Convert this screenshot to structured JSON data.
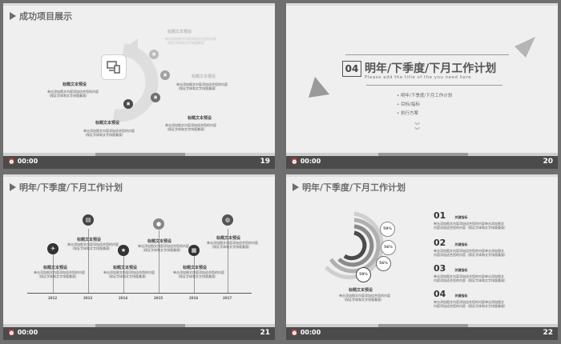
{
  "slide19": {
    "title": "成功项目展示",
    "labels": [
      "标题文本预设",
      "标题文本预设",
      "标题文本预设",
      "标题文本预设",
      "标题文本预设"
    ],
    "desc_a": "单击添加图文内容添加适合您的内容",
    "desc_b": "（保证字体和文字排版美观）",
    "time": "00:00",
    "page": "19"
  },
  "slide20": {
    "number": "04",
    "heading": "明年/下季度/下月工作计划",
    "subtitle": "Please add the title of the you need here",
    "items": [
      "明年/下季度/下月工作计划",
      "目标/指标",
      "执行方案"
    ],
    "time": "00:00",
    "page": "20"
  },
  "slide21": {
    "title": "明年/下季度/下月工作计划",
    "label": "标题文本预设",
    "desc_a": "单击添加图文内容添加适合您的内容",
    "desc_b": "（保证字体和文字排版美观）",
    "years": [
      "2012",
      "2013",
      "2014",
      "2015",
      "2016",
      "2017"
    ],
    "time": "00:00",
    "page": "21"
  },
  "slide22": {
    "title": "明年/下季度/下月工作计划",
    "percents": [
      "59%",
      "56%",
      "56%",
      "59%"
    ],
    "center_label": "标题文本预设",
    "center_desc_a": "单击添加图文内容添加适合您的内容",
    "center_desc_b": "（保证字体和文字排版美观）",
    "rows": [
      {
        "num": "01",
        "title": "关键指标",
        "line1": "单击添加图文内容添加适合您的内容单击添加图文",
        "line2": "内容添加适合您的内容（保证字体和文字排版美观）"
      },
      {
        "num": "02",
        "title": "关键指标",
        "line1": "单击添加图文内容添加适合您的内容单击添加图文",
        "line2": "内容添加适合您的内容（保证字体和文字排版美观）"
      },
      {
        "num": "03",
        "title": "关键指标",
        "line1": "单击添加图文内容添加适合您的内容单击添加图文",
        "line2": "内容添加适合您的内容（保证字体和文字排版美观）"
      },
      {
        "num": "04",
        "title": "关键指标",
        "line1": "单击添加图文内容添加适合您的内容单击添加图文",
        "line2": "内容添加适合您的内容（保证字体和文字排版美观）"
      }
    ],
    "time": "00:00",
    "page": "22"
  }
}
